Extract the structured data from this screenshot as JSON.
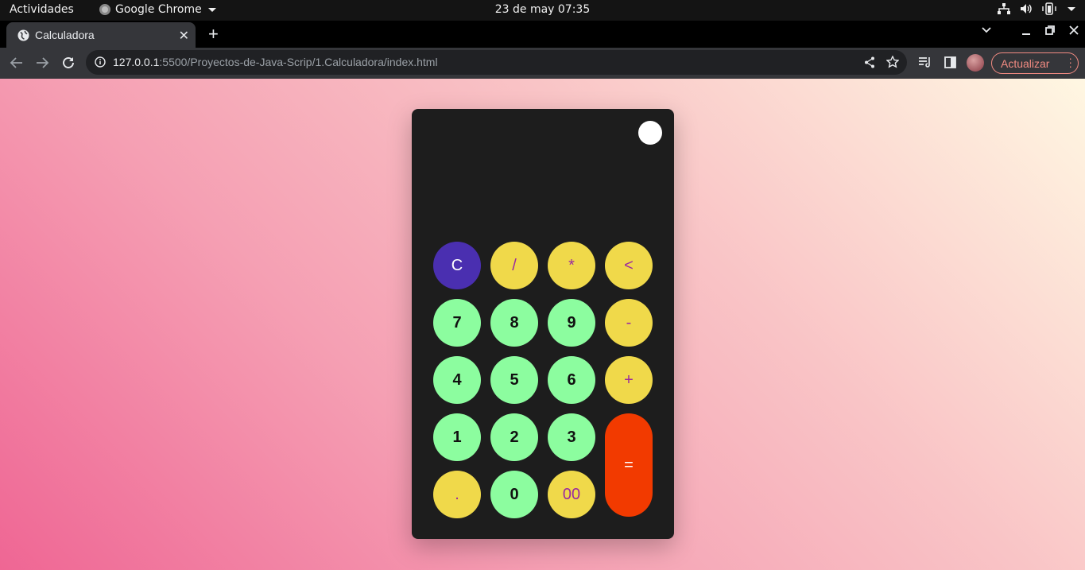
{
  "system_bar": {
    "activities": "Actividades",
    "app_name": "Google Chrome",
    "datetime": "23 de may  07:35"
  },
  "browser": {
    "tab_title": "Calculadora",
    "url_host": "127.0.0.1",
    "url_rest": ":5500/Proyectos-de-Java-Scrip/1.Calculadora/index.html",
    "update_label": "Actualizar"
  },
  "calculator": {
    "display": "",
    "keys": {
      "clear": "C",
      "divide": "/",
      "multiply": "*",
      "backspace": "<",
      "seven": "7",
      "eight": "8",
      "nine": "9",
      "minus": "-",
      "four": "4",
      "five": "5",
      "six": "6",
      "plus": "+",
      "one": "1",
      "two": "2",
      "three": "3",
      "equals": "=",
      "dot": ".",
      "zero": "0",
      "double_zero": "00"
    }
  },
  "colors": {
    "operator_key": "#f0d94a",
    "operator_text": "#9a2aa0",
    "number_key": "#8cfd9f",
    "clear_key": "#4a2fb0",
    "equals_key": "#f23a00",
    "calculator_body": "#1d1d1d"
  }
}
